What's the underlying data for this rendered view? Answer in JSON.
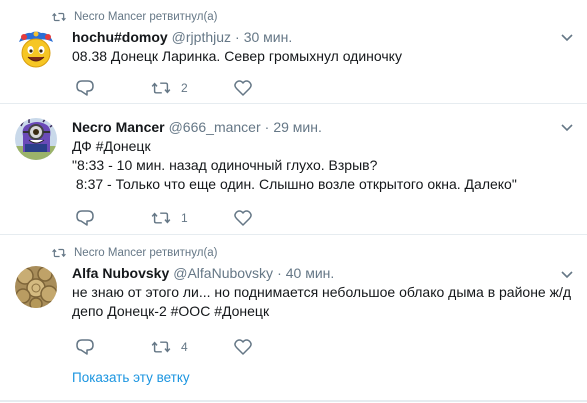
{
  "tweets": [
    {
      "context": "Necro Mancer ретвитнул(а)",
      "name": "hochu#domoy",
      "handle": "@rjpthjuz",
      "dot": "·",
      "time": "30 мин.",
      "lines": [
        "08.38 Донецк Ларинка. Север громыхнул одиночку"
      ],
      "retweets": "2",
      "likes": ""
    },
    {
      "context": "",
      "name": "Necro Mancer",
      "handle": "@666_mancer",
      "dot": "·",
      "time": "29 мин.",
      "lines": [
        "ДФ #Донецк",
        "\"8:33 - 10 мин. назад одиночный глухо. Взрыв?",
        " 8:37 - Только что еще один. Слышно возле открытого окна. Далеко\""
      ],
      "retweets": "1",
      "likes": ""
    },
    {
      "context": "Necro Mancer ретвитнул(а)",
      "name": "Alfa Nubovsky",
      "handle": "@AlfaNubovsky",
      "dot": "·",
      "time": "40 мин.",
      "lines": [
        "не знаю от этого ли... но поднимается небольшое облако дыма в районе ж/д",
        "депо Донецк-2 #ООС #Донецк"
      ],
      "retweets": "4",
      "likes": ""
    }
  ],
  "thread_link": "Показать эту ветку",
  "icons": {
    "retweet": "retweet-icon",
    "reply": "reply-icon",
    "like": "heart-icon",
    "more": "chevron-down-icon"
  },
  "colors": {
    "secondary": "#657786",
    "link": "#1b95e0",
    "divider": "#e6ecf0"
  }
}
